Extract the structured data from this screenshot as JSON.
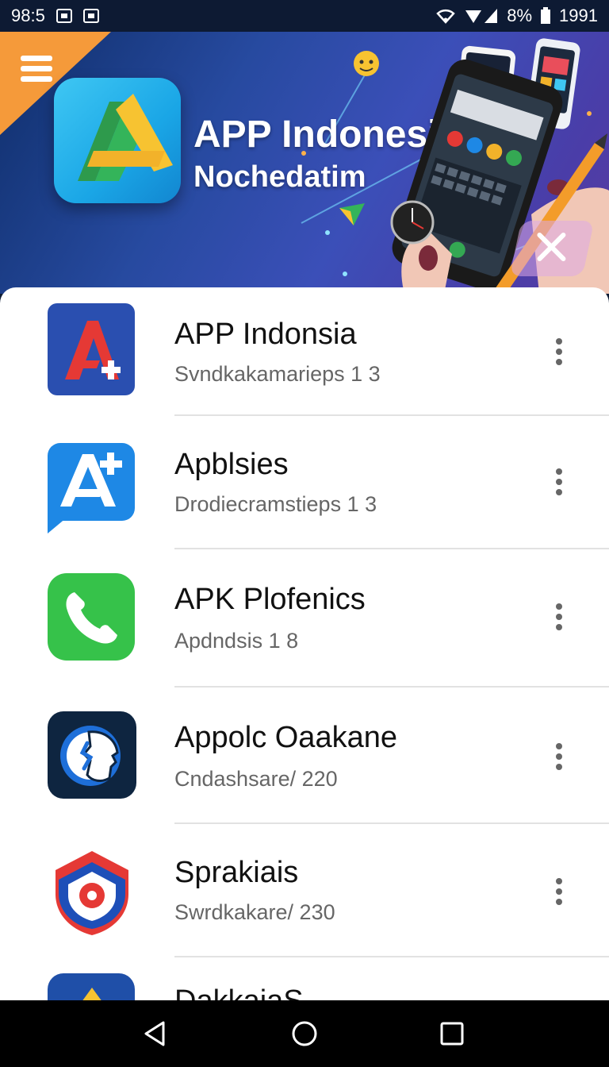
{
  "status_bar": {
    "time": "98:5",
    "battery_percent": "8%",
    "clock_right": "1991"
  },
  "banner": {
    "title": "APP Indonesia",
    "subtitle": "Nochedatim"
  },
  "list": {
    "items": [
      {
        "title": "APP Indonsia",
        "subtitle": "Svndkakamarieps  1 3",
        "icon": "red-a-plus-icon",
        "color": "#2a4fb0"
      },
      {
        "title": "Apblsies",
        "subtitle": "Drodiecramstieps  1 3",
        "icon": "a-plus-chat-icon",
        "color": "#1e88e5"
      },
      {
        "title": "APK Plofenics",
        "subtitle": "Apdndsis 1 8",
        "icon": "phone-icon",
        "color": "#36c24a"
      },
      {
        "title": "Appolc Oaakane",
        "subtitle": "Cndashsare/ 220",
        "icon": "face-profile-icon",
        "color": "#0e2540"
      },
      {
        "title": "Sprakiais",
        "subtitle": "Swrdkakare/ 230",
        "icon": "shield-icon",
        "color": "#e53935"
      },
      {
        "title": "DakkaiaS",
        "subtitle": "",
        "icon": "yellow-triangle-icon",
        "color": "#1f4fa8"
      }
    ]
  },
  "colors": {
    "accent_orange": "#f59a3a",
    "banner_blue": "#274aa0",
    "nav_bar": "#000000"
  }
}
